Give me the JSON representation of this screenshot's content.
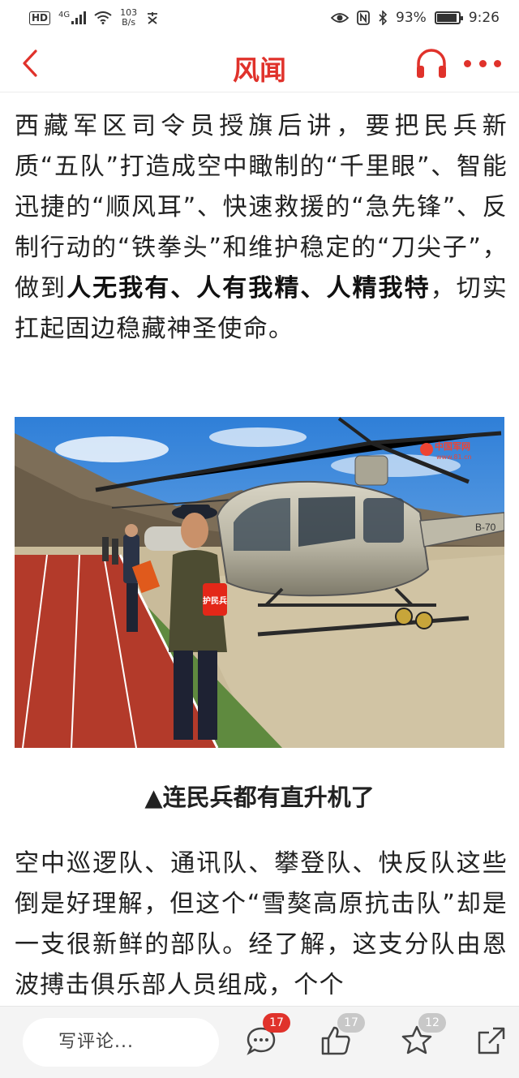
{
  "status_bar": {
    "hd": "HD",
    "network": "4G",
    "net_speed_value": "103",
    "net_speed_unit": "B/s",
    "battery": "93%",
    "battery_level": 0.93,
    "time": "9:26"
  },
  "header": {
    "title": "风闻",
    "back_icon": "chevron-left-icon",
    "audio_icon": "headphones-icon",
    "more_icon": "more-dots-icon",
    "accent_color": "#e0322b"
  },
  "article": {
    "paragraph1_a": "西藏军区司令员授旗后讲，要把民兵新质“五队”打造成空中瞰制的“千里眼”、智能迅捷的“顺风耳”、快速救援的“急先锋”、反制行动的“铁拳头”和维护稳定的“刀尖子”，做到",
    "paragraph1_bold": "人无我有、人有我精、人精我特",
    "paragraph1_b": "，切实扛起固边稳藏神圣使命。",
    "image_watermark": "中国军网",
    "image_watermark_url": "www.81.cn",
    "armband_text": "护民兵",
    "heli_reg": "B-70",
    "caption": "▲连民兵都有直升机了",
    "paragraph2": "空中巡逻队、通讯队、攀登队、快反队这些倒是好理解，但这个“雪獒高原抗击队”却是一支很新鲜的部队。经了解，这支分队由恩波搏击俱乐部人员组成，个个"
  },
  "bottom_bar": {
    "comment_placeholder": "写评论...",
    "comment_count": "17",
    "like_count": "17",
    "favorite_count": "12",
    "icons": [
      "comment-icon",
      "thumbs-up-icon",
      "star-icon",
      "share-icon"
    ]
  }
}
